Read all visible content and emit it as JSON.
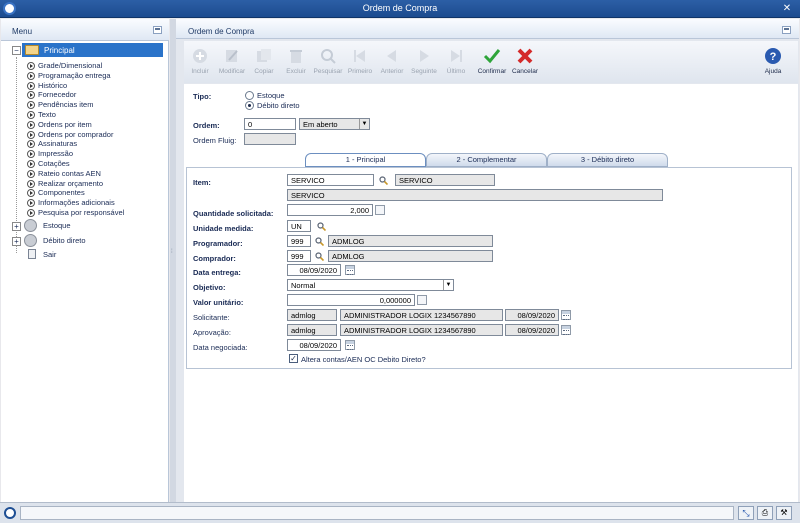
{
  "window": {
    "title": "Ordem de Compra"
  },
  "menu": {
    "title": "Menu",
    "root": "Principal",
    "items": [
      "Grade/Dimensional",
      "Programação entrega",
      "Histórico",
      "Fornecedor",
      "Pendências item",
      "Texto",
      "Ordens por item",
      "Ordens por comprador",
      "Assinaturas",
      "Impressão",
      "Cotações",
      "Rateio contas AEN",
      "Realizar orçamento",
      "Componentes",
      "Informações adicionais",
      "Pesquisa por responsável"
    ],
    "groups": [
      "Estoque",
      "Débito direto",
      "Sair"
    ]
  },
  "main": {
    "title": "Ordem de Compra"
  },
  "toolbar": {
    "buttons": [
      "Incluir",
      "Modificar",
      "Copiar",
      "Excluir",
      "Pesquisar",
      "Primeiro",
      "Anterior",
      "Seguinte",
      "Último",
      "Confirmar",
      "Cancelar"
    ],
    "help": "Ajuda"
  },
  "header": {
    "tipo_label": "Tipo:",
    "tipo_options": [
      "Estoque",
      "Débito direto"
    ],
    "tipo_selected": "Débito direto",
    "ordem_label": "Ordem:",
    "ordem_value": "0",
    "status_value": "Em aberto",
    "ordem_fluig_label": "Ordem Fluig:",
    "ordem_fluig_value": ""
  },
  "tabs": [
    "1 - Principal",
    "2 - Complementar",
    "3 - Débito direto"
  ],
  "form": {
    "item_label": "Item:",
    "item_code": "SERVICO",
    "item_desc": "SERVICO",
    "item_desc2": "SERVICO",
    "qtd_label": "Quantidade solicitada:",
    "qtd_value": "2,000",
    "un_label": "Unidade medida:",
    "un_value": "UN",
    "prog_label": "Programador:",
    "prog_code": "999",
    "prog_name": "ADMLOG",
    "comp_label": "Comprador:",
    "comp_code": "999",
    "comp_name": "ADMLOG",
    "data_entrega_label": "Data entrega:",
    "data_entrega_value": "08/09/2020",
    "objetivo_label": "Objetivo:",
    "objetivo_value": "Normal",
    "valor_label": "Valor unitário:",
    "valor_value": "0,000000",
    "solic_label": "Solicitante:",
    "solic_user": "admlog",
    "solic_name": "ADMINISTRADOR LOGIX 1234567890",
    "solic_date": "08/09/2020",
    "aprov_label": "Aprovação:",
    "aprov_user": "admlog",
    "aprov_name": "ADMINISTRADOR LOGIX 1234567890",
    "aprov_date": "08/09/2020",
    "data_neg_label": "Data negociada:",
    "data_neg_value": "08/09/2020",
    "altera_label": "Altera contas/AEN OC Debito Direto?",
    "altera_checked": true
  },
  "colors": {
    "titlebar": "#1f4f94",
    "accent": "#2a73c9",
    "confirm": "#2ea53a",
    "cancel": "#d42a2a"
  }
}
